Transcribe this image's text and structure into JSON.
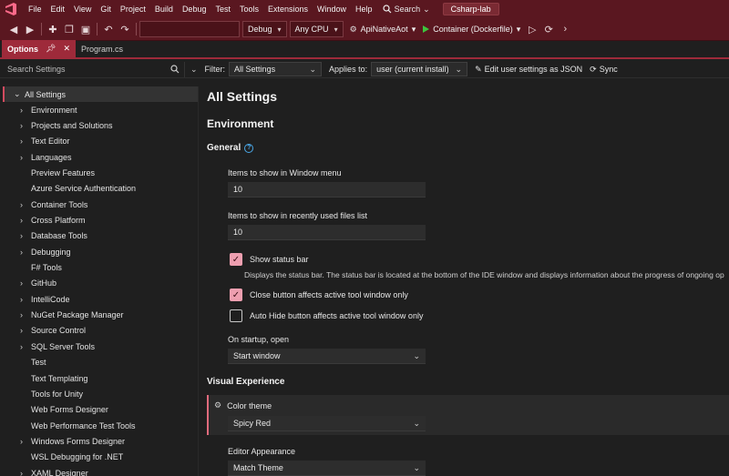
{
  "menubar": {
    "items": [
      "File",
      "Edit",
      "View",
      "Git",
      "Project",
      "Build",
      "Debug",
      "Test",
      "Tools",
      "Extensions",
      "Window",
      "Help"
    ],
    "search_label": "Search",
    "solution_name": "Csharp-lab"
  },
  "toolbar": {
    "configuration": "Debug",
    "platform": "Any CPU",
    "startup_project": "ApiNativeAot",
    "run_target": "Container (Dockerfile)"
  },
  "tabs": [
    {
      "label": "Options",
      "active": true
    },
    {
      "label": "Program.cs",
      "active": false
    }
  ],
  "options_header": {
    "search_placeholder": "Search Settings",
    "filter_label": "Filter:",
    "filter_value": "All Settings",
    "applies_label": "Applies to:",
    "applies_value": "user (current install)",
    "edit_json_label": "Edit user settings as JSON",
    "sync_label": "Sync"
  },
  "tree": {
    "root": "All Settings",
    "items": [
      {
        "label": "Environment",
        "expandable": true
      },
      {
        "label": "Projects and Solutions",
        "expandable": true
      },
      {
        "label": "Text Editor",
        "expandable": true
      },
      {
        "label": "Languages",
        "expandable": true
      },
      {
        "label": "Preview Features",
        "expandable": false
      },
      {
        "label": "Azure Service Authentication",
        "expandable": false
      },
      {
        "label": "Container Tools",
        "expandable": true
      },
      {
        "label": "Cross Platform",
        "expandable": true
      },
      {
        "label": "Database Tools",
        "expandable": true
      },
      {
        "label": "Debugging",
        "expandable": true
      },
      {
        "label": "F# Tools",
        "expandable": false
      },
      {
        "label": "GitHub",
        "expandable": true
      },
      {
        "label": "IntelliCode",
        "expandable": true
      },
      {
        "label": "NuGet Package Manager",
        "expandable": true
      },
      {
        "label": "Source Control",
        "expandable": true
      },
      {
        "label": "SQL Server Tools",
        "expandable": true
      },
      {
        "label": "Test",
        "expandable": false
      },
      {
        "label": "Text Templating",
        "expandable": false
      },
      {
        "label": "Tools for Unity",
        "expandable": false
      },
      {
        "label": "Web Forms Designer",
        "expandable": false
      },
      {
        "label": "Web Performance Test Tools",
        "expandable": false
      },
      {
        "label": "Windows Forms Designer",
        "expandable": true
      },
      {
        "label": "WSL Debugging for .NET",
        "expandable": false
      },
      {
        "label": "XAML Designer",
        "expandable": true
      }
    ]
  },
  "main": {
    "title": "All Settings",
    "section_environment": "Environment",
    "subsection_general": "General",
    "window_menu_label": "Items to show in Window menu",
    "window_menu_value": "10",
    "recent_files_label": "Items to show in recently used files list",
    "recent_files_value": "10",
    "show_status_bar_label": "Show status bar",
    "show_status_bar_checked": true,
    "show_status_bar_desc": "Displays the status bar. The status bar is located at the bottom of the IDE window and displays information about the progress of ongoing op",
    "close_button_label": "Close button affects active tool window only",
    "close_button_checked": true,
    "auto_hide_label": "Auto Hide button affects active tool window only",
    "auto_hide_checked": false,
    "startup_label": "On startup, open",
    "startup_value": "Start window",
    "section_visual": "Visual Experience",
    "color_theme_label": "Color theme",
    "color_theme_value": "Spicy Red",
    "editor_appearance_label": "Editor Appearance",
    "editor_appearance_value": "Match Theme"
  },
  "colors": {
    "title_bar": "#5a1720",
    "accent": "#9e2a3a",
    "checkbox_on": "#ee9fb0",
    "background": "#1f1f1f"
  }
}
